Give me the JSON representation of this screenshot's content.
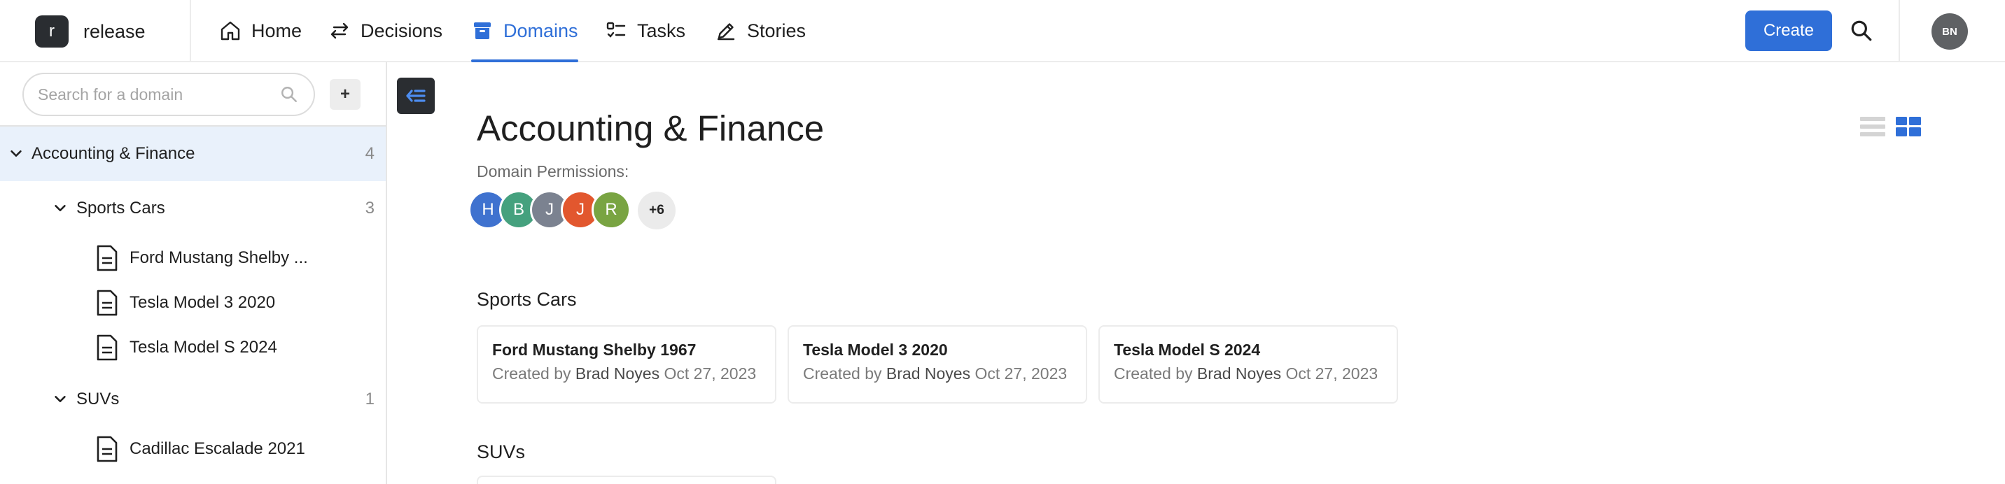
{
  "app": {
    "logo_letter": "r",
    "name": "release"
  },
  "nav": [
    {
      "label": "Home",
      "icon": "home-icon",
      "active": false
    },
    {
      "label": "Decisions",
      "icon": "arrows-swap-icon",
      "active": false
    },
    {
      "label": "Domains",
      "icon": "box-icon",
      "active": true
    },
    {
      "label": "Tasks",
      "icon": "checklist-icon",
      "active": false
    },
    {
      "label": "Stories",
      "icon": "pencil-icon",
      "active": false
    }
  ],
  "topbar": {
    "create_label": "Create",
    "search_icon": "search-icon",
    "user_initials": "BN"
  },
  "colors": {
    "accent": "#2f6fd8",
    "dark": "#2a2d31",
    "selected_row": "#e9f1fb"
  },
  "sidebar": {
    "search_placeholder": "Search for a domain",
    "add_label": "+",
    "tree": [
      {
        "label": "Accounting & Finance",
        "count": "4",
        "type": "domain",
        "level": 0,
        "expanded": true,
        "selected": true
      },
      {
        "label": "Sports Cars",
        "count": "3",
        "type": "domain",
        "level": 1,
        "expanded": true,
        "selected": false
      },
      {
        "label": "Ford Mustang Shelby ...",
        "count": "",
        "type": "document",
        "level": 2
      },
      {
        "label": "Tesla Model 3 2020",
        "count": "",
        "type": "document",
        "level": 2
      },
      {
        "label": "Tesla Model S 2024",
        "count": "",
        "type": "document",
        "level": 2
      },
      {
        "label": "SUVs",
        "count": "1",
        "type": "domain",
        "level": 1,
        "expanded": true,
        "selected": false
      },
      {
        "label": "Cadillac Escalade 2021",
        "count": "",
        "type": "document",
        "level": 2
      }
    ]
  },
  "main": {
    "title": "Accounting & Finance",
    "permissions_label": "Domain Permissions:",
    "permissions": [
      {
        "initial": "H",
        "color": "#3f72cf"
      },
      {
        "initial": "B",
        "color": "#45a17e"
      },
      {
        "initial": "J",
        "color": "#7b8290"
      },
      {
        "initial": "J",
        "color": "#e2572e"
      },
      {
        "initial": "R",
        "color": "#79a442"
      }
    ],
    "permissions_more": "+6",
    "view_modes": [
      {
        "name": "list-view",
        "active": false
      },
      {
        "name": "grid-view",
        "active": true
      }
    ],
    "sections": [
      {
        "title": "Sports Cars",
        "cards": [
          {
            "title": "Ford Mustang Shelby 1967",
            "created_prefix": "Created by",
            "author": "Brad Noyes",
            "date": "Oct 27, 2023"
          },
          {
            "title": "Tesla Model 3 2020",
            "created_prefix": "Created by",
            "author": "Brad Noyes",
            "date": "Oct 27, 2023"
          },
          {
            "title": "Tesla Model S 2024",
            "created_prefix": "Created by",
            "author": "Brad Noyes",
            "date": "Oct 27, 2023"
          }
        ]
      },
      {
        "title": "SUVs",
        "cards": []
      }
    ]
  }
}
